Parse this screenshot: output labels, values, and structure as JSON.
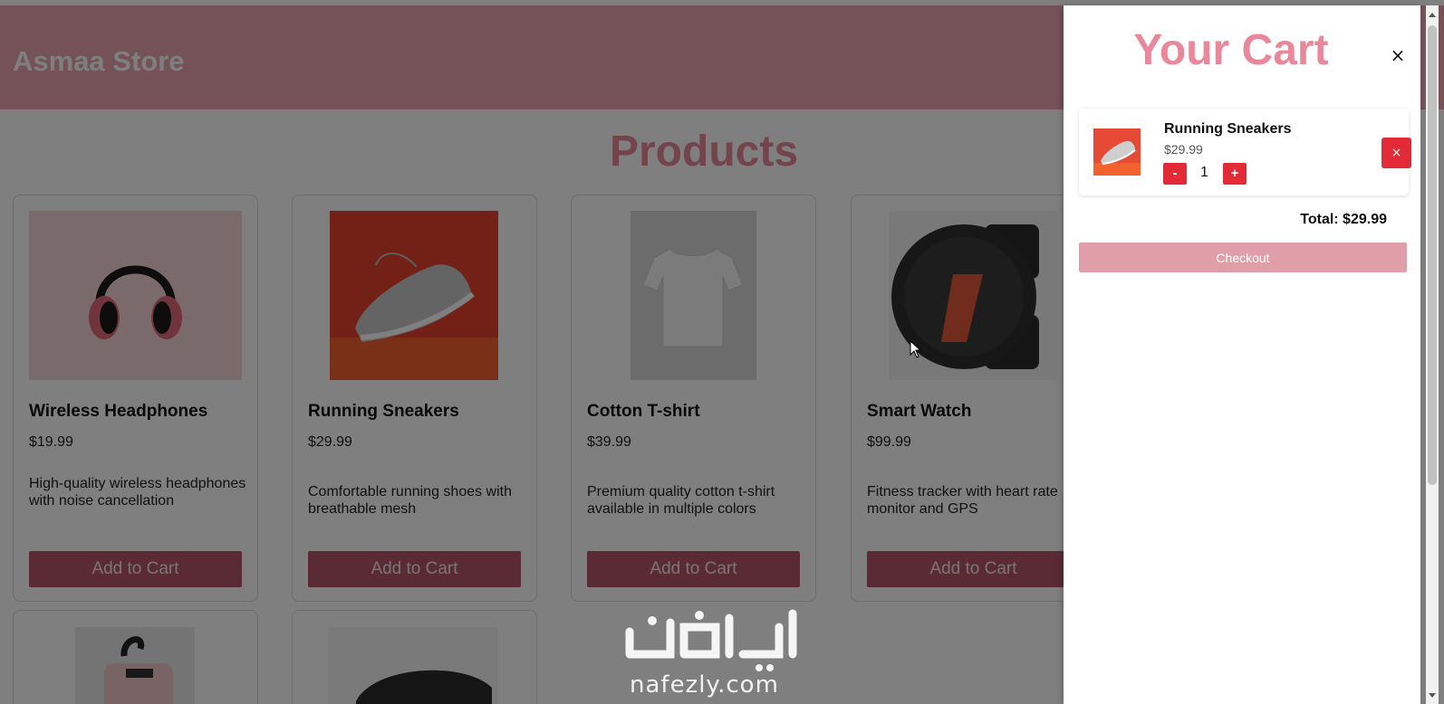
{
  "store": {
    "title": "Asmaa Store",
    "products_heading": "Products",
    "products": [
      {
        "name": "Wireless Headphones",
        "price": "$19.99",
        "description": "High-quality wireless headphones with noise cancellation",
        "button": "Add to Cart",
        "image_icon": "headphones-image"
      },
      {
        "name": "Running Sneakers",
        "price": "$29.99",
        "description": "Comfortable running shoes with breathable mesh",
        "button": "Add to Cart",
        "image_icon": "sneaker-image"
      },
      {
        "name": "Cotton T-shirt",
        "price": "$39.99",
        "description": "Premium quality cotton t-shirt available in multiple colors",
        "button": "Add to Cart",
        "image_icon": "tshirt-image"
      },
      {
        "name": "Smart Watch",
        "price": "$99.99",
        "description": "Fitness tracker with heart rate monitor and GPS",
        "button": "Add to Cart",
        "image_icon": "smartwatch-image"
      }
    ]
  },
  "cart": {
    "title": "Your Cart",
    "close_label": "×",
    "items": [
      {
        "name": "Running Sneakers",
        "price": "$29.99",
        "quantity": "1",
        "decrease_label": "-",
        "increase_label": "+",
        "remove_label": "×"
      }
    ],
    "total": "Total: $29.99",
    "checkout_label": "Checkout"
  },
  "watermark": {
    "domain": "nafezly.com",
    "arabic_text": "نفذلي"
  },
  "colors": {
    "header": "#e8a5b0",
    "accent_pink": "#e9889a",
    "add_button": "#b4566a",
    "cart_red": "#e22b36",
    "checkout": "#e09fa8"
  }
}
